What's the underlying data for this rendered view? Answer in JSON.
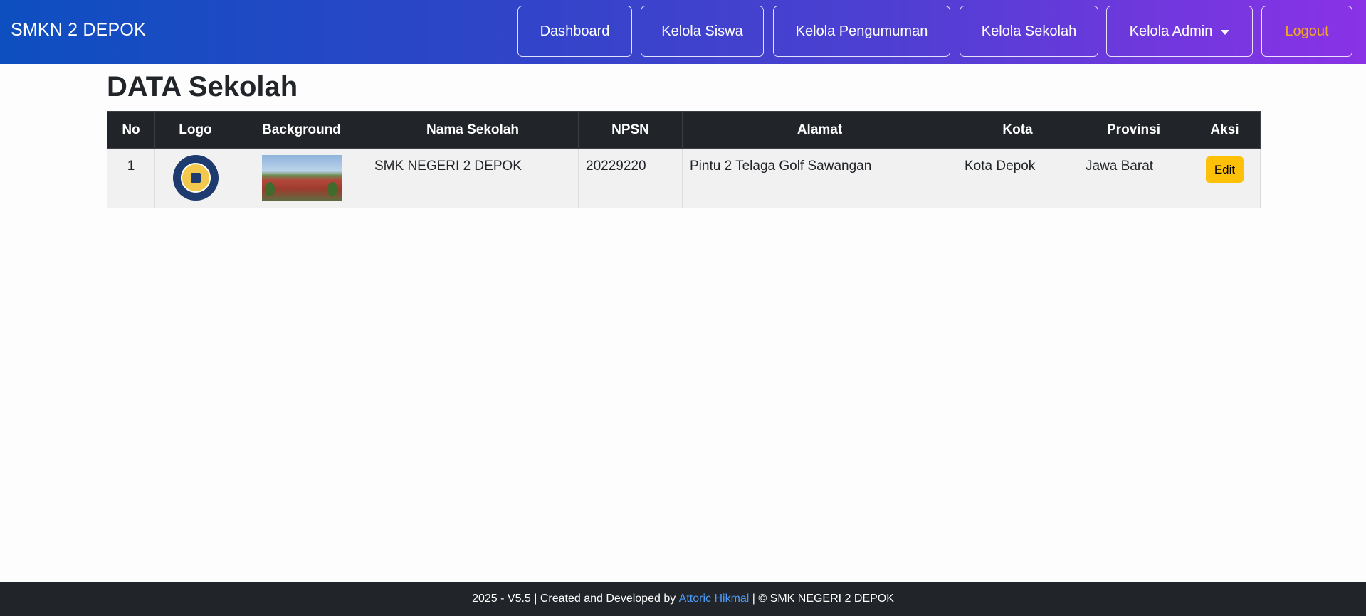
{
  "navbar": {
    "brand": "SMKN 2 DEPOK",
    "items": [
      {
        "label": "Dashboard"
      },
      {
        "label": "Kelola Siswa"
      },
      {
        "label": "Kelola Pengumuman"
      },
      {
        "label": "Kelola Sekolah"
      },
      {
        "label": "Kelola Admin"
      },
      {
        "label": "Logout"
      }
    ],
    "logout_color": "#f5a623"
  },
  "main": {
    "title": "DATA Sekolah",
    "table": {
      "headers": [
        "No",
        "Logo",
        "Background",
        "Nama Sekolah",
        "NPSN",
        "Alamat",
        "Kota",
        "Provinsi",
        "Aksi"
      ],
      "rows": [
        {
          "no": "1",
          "logo": "school-logo-image",
          "background": "school-building-photo",
          "nama_sekolah": "SMK NEGERI 2 DEPOK",
          "npsn": "20229220",
          "alamat": "Pintu 2 Telaga Golf Sawangan",
          "kota": "Kota Depok",
          "provinsi": "Jawa Barat",
          "aksi": "Edit"
        }
      ]
    }
  },
  "footer": {
    "prefix": "2025 - V5.5 | Created and Developed by ",
    "author": "Attoric Hikmal",
    "suffix": " | © SMK NEGERI 2 DEPOK",
    "link_color": "#4d9cf7"
  }
}
